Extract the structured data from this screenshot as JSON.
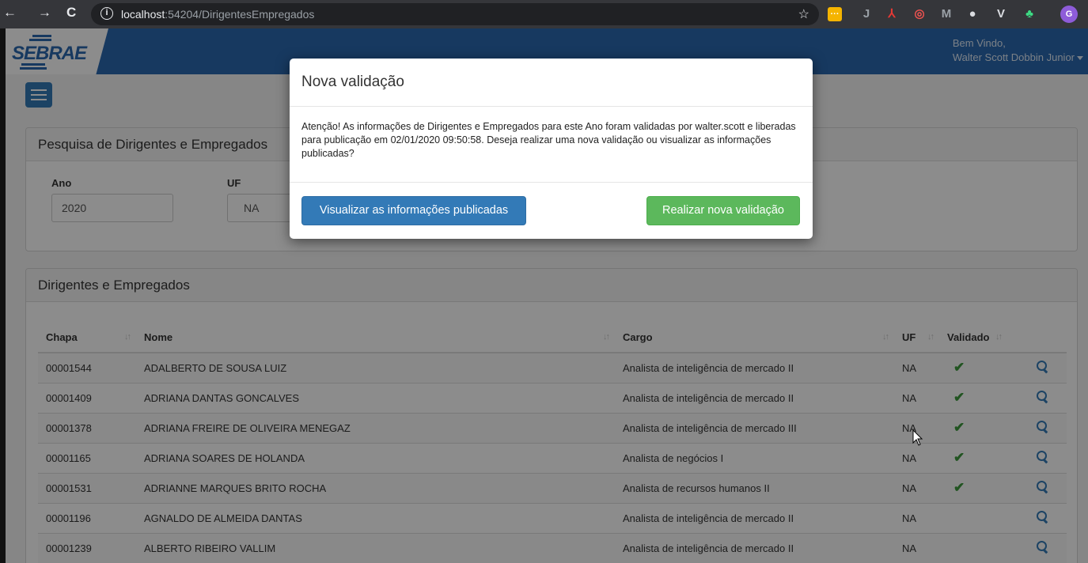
{
  "browser": {
    "back": "←",
    "forward": "→",
    "reload": "C",
    "url_host": "localhost",
    "url_path": ":54204/DirigentesEmpregados",
    "extensions": [
      {
        "name": "ext-yellow-icon",
        "glyph": "···",
        "color": "#f5b400"
      },
      {
        "name": "ext-j-icon",
        "glyph": "J",
        "color": "#9aa0a6"
      },
      {
        "name": "ext-pdf-icon",
        "glyph": "⅄",
        "color": "#e53935"
      },
      {
        "name": "ext-swirl-icon",
        "glyph": "◎",
        "color": "#ef5350"
      },
      {
        "name": "ext-m-icon",
        "glyph": "M",
        "color": "#9aa0a6"
      },
      {
        "name": "ext-circle-icon",
        "glyph": "●",
        "color": "#dadce0"
      },
      {
        "name": "ext-v-icon",
        "glyph": "V",
        "color": "#dadce0"
      },
      {
        "name": "ext-android-icon",
        "glyph": "♣",
        "color": "#3ddc84"
      },
      {
        "name": "profile-avatar-icon",
        "glyph": "G",
        "color": "#8e5cd9"
      }
    ]
  },
  "app": {
    "logo": "SEBRAE",
    "welcome_line1": "Bem Vindo,",
    "welcome_line2": "Walter Scott Dobbin Junior"
  },
  "search_panel": {
    "title": "Pesquisa de Dirigentes e Empregados",
    "ano_label": "Ano",
    "ano_value": "2020",
    "uf_label": "UF",
    "uf_value": "NA"
  },
  "list_panel": {
    "title": "Dirigentes e Empregados",
    "columns": [
      "Chapa",
      "Nome",
      "Cargo",
      "UF",
      "Validado"
    ],
    "sort_glyph": "↓↑",
    "check_glyph": "✔",
    "rows": [
      {
        "chapa": "00001544",
        "nome": "ADALBERTO DE SOUSA LUIZ",
        "cargo": "Analista de inteligência de mercado II",
        "uf": "NA",
        "validado": true
      },
      {
        "chapa": "00001409",
        "nome": "ADRIANA DANTAS GONCALVES",
        "cargo": "Analista de inteligência de mercado II",
        "uf": "NA",
        "validado": true
      },
      {
        "chapa": "00001378",
        "nome": "ADRIANA FREIRE DE OLIVEIRA MENEGAZ",
        "cargo": "Analista de inteligência de mercado III",
        "uf": "NA",
        "validado": true
      },
      {
        "chapa": "00001165",
        "nome": "ADRIANA SOARES DE HOLANDA",
        "cargo": "Analista de negócios I",
        "uf": "NA",
        "validado": true
      },
      {
        "chapa": "00001531",
        "nome": "ADRIANNE MARQUES BRITO ROCHA",
        "cargo": "Analista de recursos humanos II",
        "uf": "NA",
        "validado": true
      },
      {
        "chapa": "00001196",
        "nome": "AGNALDO DE ALMEIDA DANTAS",
        "cargo": "Analista de inteligência de mercado II",
        "uf": "NA",
        "validado": false
      },
      {
        "chapa": "00001239",
        "nome": "ALBERTO RIBEIRO VALLIM",
        "cargo": "Analista de inteligência de mercado II",
        "uf": "NA",
        "validado": false
      }
    ]
  },
  "modal": {
    "title": "Nova validação",
    "body": "Atenção! As informações de Dirigentes e Empregados para este Ano foram validadas por walter.scott e liberadas para publicação em 02/01/2020 09:50:58. Deseja realizar uma nova validação ou visualizar as informações publicadas?",
    "btn_view": "Visualizar as informações publicadas",
    "btn_new": "Realizar nova validação"
  },
  "colors": {
    "brand_blue": "#2b68b0",
    "primary": "#337ab7",
    "success": "#5cb85c",
    "check_green": "#3c9a3c"
  }
}
